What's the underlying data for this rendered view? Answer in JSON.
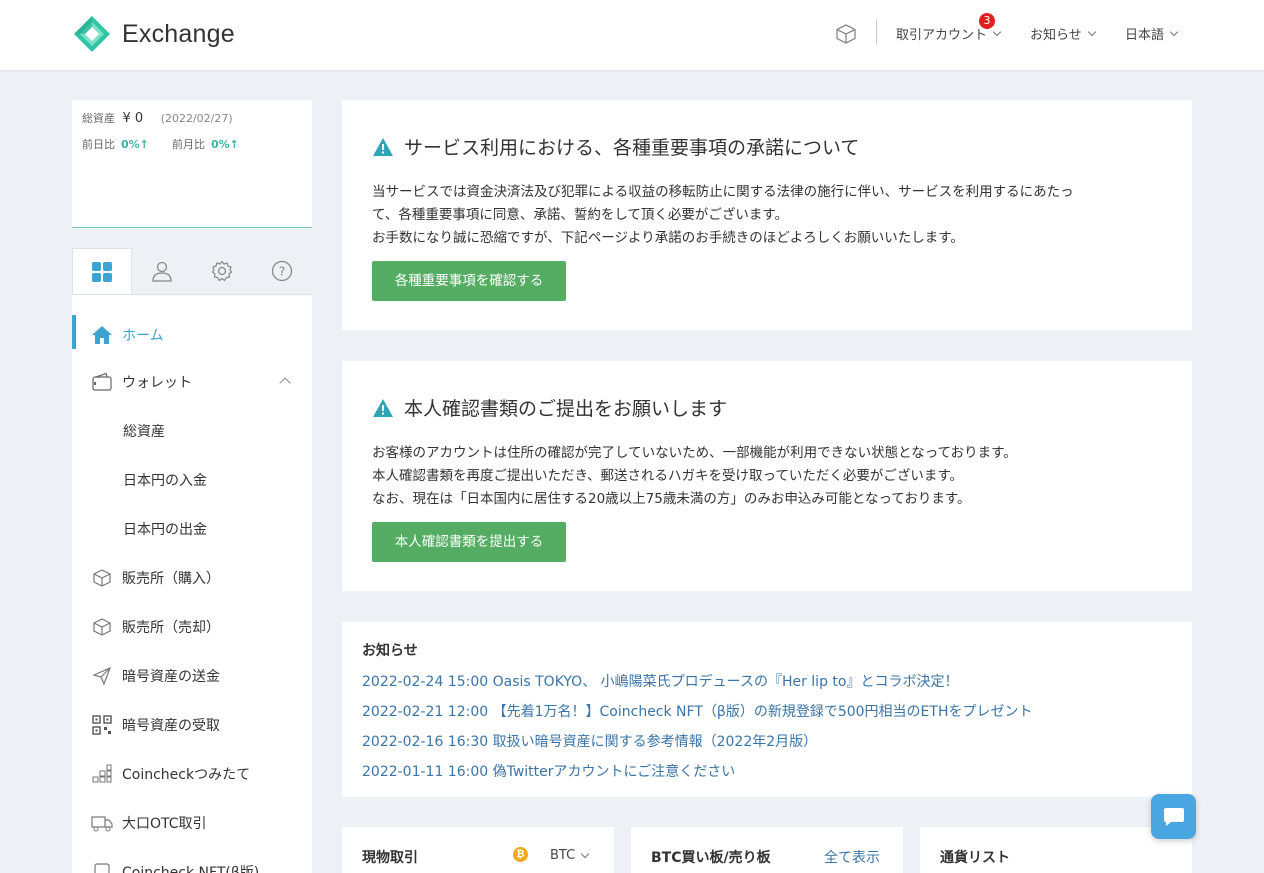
{
  "header": {
    "app_title": "Exchange",
    "menu_account": "取引アカウント",
    "account_badge": "3",
    "menu_news": "お知らせ",
    "menu_language": "日本語"
  },
  "summary": {
    "total_label": "総資産",
    "total_value": "¥ 0",
    "date": "(2022/02/27)",
    "day_label": "前日比",
    "day_value": "0%↑",
    "month_label": "前月比",
    "month_value": "0%↑"
  },
  "tabs": [
    "dashboard",
    "account",
    "settings",
    "help"
  ],
  "nav": {
    "home": "ホーム",
    "wallet": "ウォレット",
    "total_assets": "総資産",
    "jpy_deposit": "日本円の入金",
    "jpy_withdraw": "日本円の出金",
    "buy": "販売所（購入）",
    "sell": "販売所（売却）",
    "send": "暗号資産の送金",
    "receive": "暗号資産の受取",
    "tsumitate": "Coincheckつみたて",
    "otc": "大口OTC取引",
    "nft": "Coincheck NFT(β版)"
  },
  "notice1": {
    "title": "サービス利用における、各種重要事項の承諾について",
    "line1": "当サービスでは資金決済法及び犯罪による収益の移転防止に関する法律の施行に伴い、サービスを利用するにあたっ",
    "line2": "て、各種重要事項に同意、承諾、誓約をして頂く必要がございます。",
    "line3": "お手数になり誠に恐縮ですが、下記ページより承諾のお手続きのほどよろしくお願いいたします。",
    "button": "各種重要事項を確認する"
  },
  "notice2": {
    "title": "本人確認書類のご提出をお願いします",
    "line1": "お客様のアカウントは住所の確認が完了していないため、一部機能が利用できない状態となっております。",
    "line2": "本人確認書類を再度ご提出いただき、郵送されるハガキを受け取っていただく必要がございます。",
    "line3": "なお、現在は「日本国内に居住する20歳以上75歳未満の方」のみお申込み可能となっております。",
    "button": "本人確認書類を提出する"
  },
  "news": {
    "title": "お知らせ",
    "items": [
      "2022-02-24 15:00 Oasis TOKYO、 小嶋陽菜氏プロデュースの『Her lip to』とコラボ決定！",
      "2022-02-21 12:00 【先着1万名！】Coincheck NFT（β版）の新規登録で500円相当のETHをプレゼント",
      "2022-02-16 16:30 取扱い暗号資産に関する参考情報（2022年2月版）",
      "2022-01-11 16:00 偽Twitterアカウントにご注意ください"
    ]
  },
  "bottom": {
    "spot_title": "現物取引",
    "spot_pair": "BTC",
    "book_title": "BTC買い板/売り板",
    "book_link": "全て表示",
    "currency_title": "通貨リスト"
  },
  "colors": {
    "accent": "#3ba4d0",
    "button": "#55ad63",
    "link": "#3a74a8",
    "brand": "#2fc4a4"
  }
}
